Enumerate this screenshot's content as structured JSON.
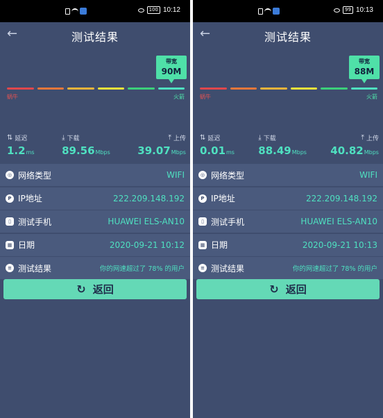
{
  "screens": [
    {
      "status": {
        "time": "10:12",
        "battery": "100"
      },
      "title": "测试结果",
      "bubble": {
        "label": "带宽",
        "value": "90M"
      },
      "gauge": {
        "slow": "蜗牛",
        "fast": "火箭",
        "colors": [
          "#e0474c",
          "#e8773a",
          "#f0b43a",
          "#f2e23a",
          "#3cd07a",
          "#4fe0c0"
        ]
      },
      "stats": {
        "latency": {
          "label": "延迟",
          "value": "1.2",
          "unit": "ms"
        },
        "download": {
          "label": "下载",
          "value": "89.56",
          "unit": "Mbps"
        },
        "upload": {
          "label": "上传",
          "value": "39.07",
          "unit": "Mbps"
        }
      },
      "rows": [
        {
          "icon": "globe-icon",
          "glyph": "◎",
          "label": "网络类型",
          "value": "WIFI"
        },
        {
          "icon": "ip-icon",
          "glyph": "P",
          "label": "IP地址",
          "value": "222.209.148.192"
        },
        {
          "icon": "phone-icon",
          "glyph": "▯",
          "label": "测试手机",
          "value": "HUAWEI ELS-AN10"
        },
        {
          "icon": "calendar-icon",
          "glyph": "▦",
          "label": "日期",
          "value": "2020-09-21 10:12"
        },
        {
          "icon": "report-icon",
          "glyph": "≡",
          "label": "测试结果",
          "value": "你的网速超过了 78% 的用户"
        }
      ],
      "button": "返回"
    },
    {
      "status": {
        "time": "10:13",
        "battery": "99"
      },
      "title": "测试结果",
      "bubble": {
        "label": "带宽",
        "value": "88M"
      },
      "gauge": {
        "slow": "蜗牛",
        "fast": "火箭",
        "colors": [
          "#e0474c",
          "#e8773a",
          "#f0b43a",
          "#f2e23a",
          "#3cd07a",
          "#4fe0c0"
        ]
      },
      "stats": {
        "latency": {
          "label": "延迟",
          "value": "0.01",
          "unit": "ms"
        },
        "download": {
          "label": "下载",
          "value": "88.49",
          "unit": "Mbps"
        },
        "upload": {
          "label": "上传",
          "value": "40.82",
          "unit": "Mbps"
        }
      },
      "rows": [
        {
          "icon": "globe-icon",
          "glyph": "◎",
          "label": "网络类型",
          "value": "WIFI"
        },
        {
          "icon": "ip-icon",
          "glyph": "P",
          "label": "IP地址",
          "value": "222.209.148.192"
        },
        {
          "icon": "phone-icon",
          "glyph": "▯",
          "label": "测试手机",
          "value": "HUAWEI ELS-AN10"
        },
        {
          "icon": "calendar-icon",
          "glyph": "▦",
          "label": "日期",
          "value": "2020-09-21 10:13"
        },
        {
          "icon": "report-icon",
          "glyph": "≡",
          "label": "测试结果",
          "value": "你的网速超过了 78% 的用户"
        }
      ],
      "button": "返回"
    }
  ]
}
